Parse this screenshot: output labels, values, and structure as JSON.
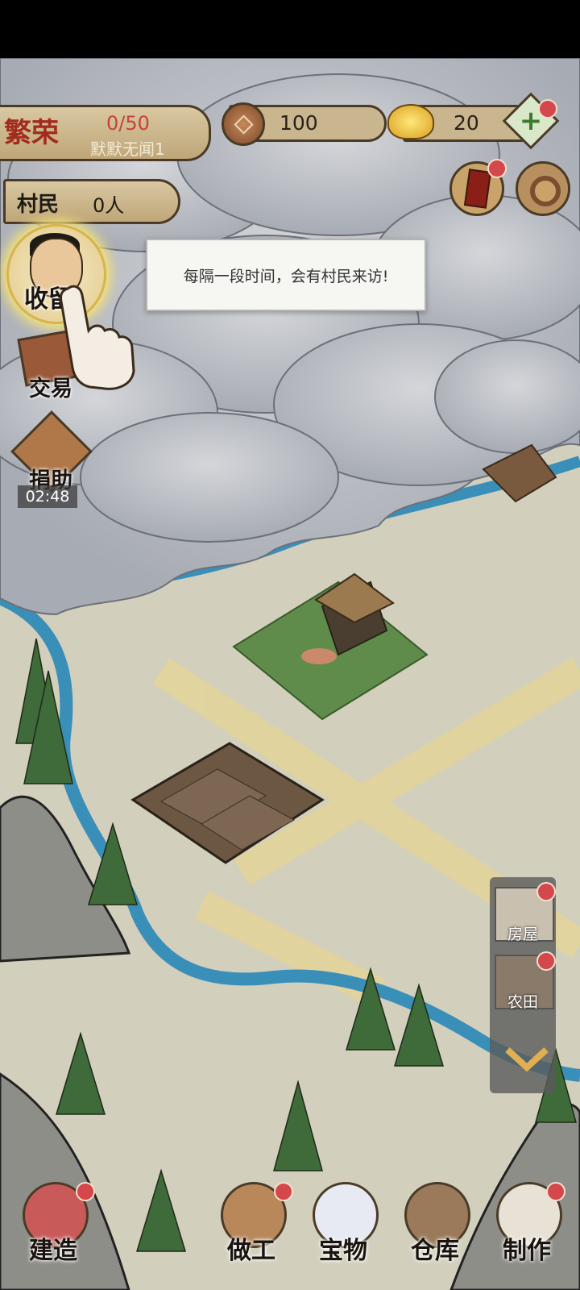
{
  "hud": {
    "prosperity_label": "繁荣",
    "prosperity_count": "0/50",
    "rank_title": "默默无闻1",
    "coins": "100",
    "gold": "20",
    "villagers_label": "村民",
    "villagers_count": "0人"
  },
  "left_menu": {
    "collect_label": "收留",
    "trade_label": "交易",
    "donate_label": "捐助",
    "donate_timer": "02:48"
  },
  "tooltip": {
    "text": "每隔一段时间，会有村民来访!"
  },
  "build_panel": {
    "items": [
      {
        "label": "房屋",
        "icon": "house-icon"
      },
      {
        "label": "农田",
        "icon": "farmland-icon"
      }
    ]
  },
  "bottom_bar": {
    "items": [
      {
        "label": "建造",
        "icon": "build-icon"
      },
      {
        "label": "做工",
        "icon": "work-icon"
      },
      {
        "label": "宝物",
        "icon": "treasure-vase-icon"
      },
      {
        "label": "仓库",
        "icon": "warehouse-icon"
      },
      {
        "label": "制作",
        "icon": "cooking-icon"
      }
    ]
  },
  "colors": {
    "notification_dot": "#d4474a",
    "river": "#3a8fb8",
    "ground": "#d3cfbd",
    "cloud": "#b9bcc2"
  }
}
